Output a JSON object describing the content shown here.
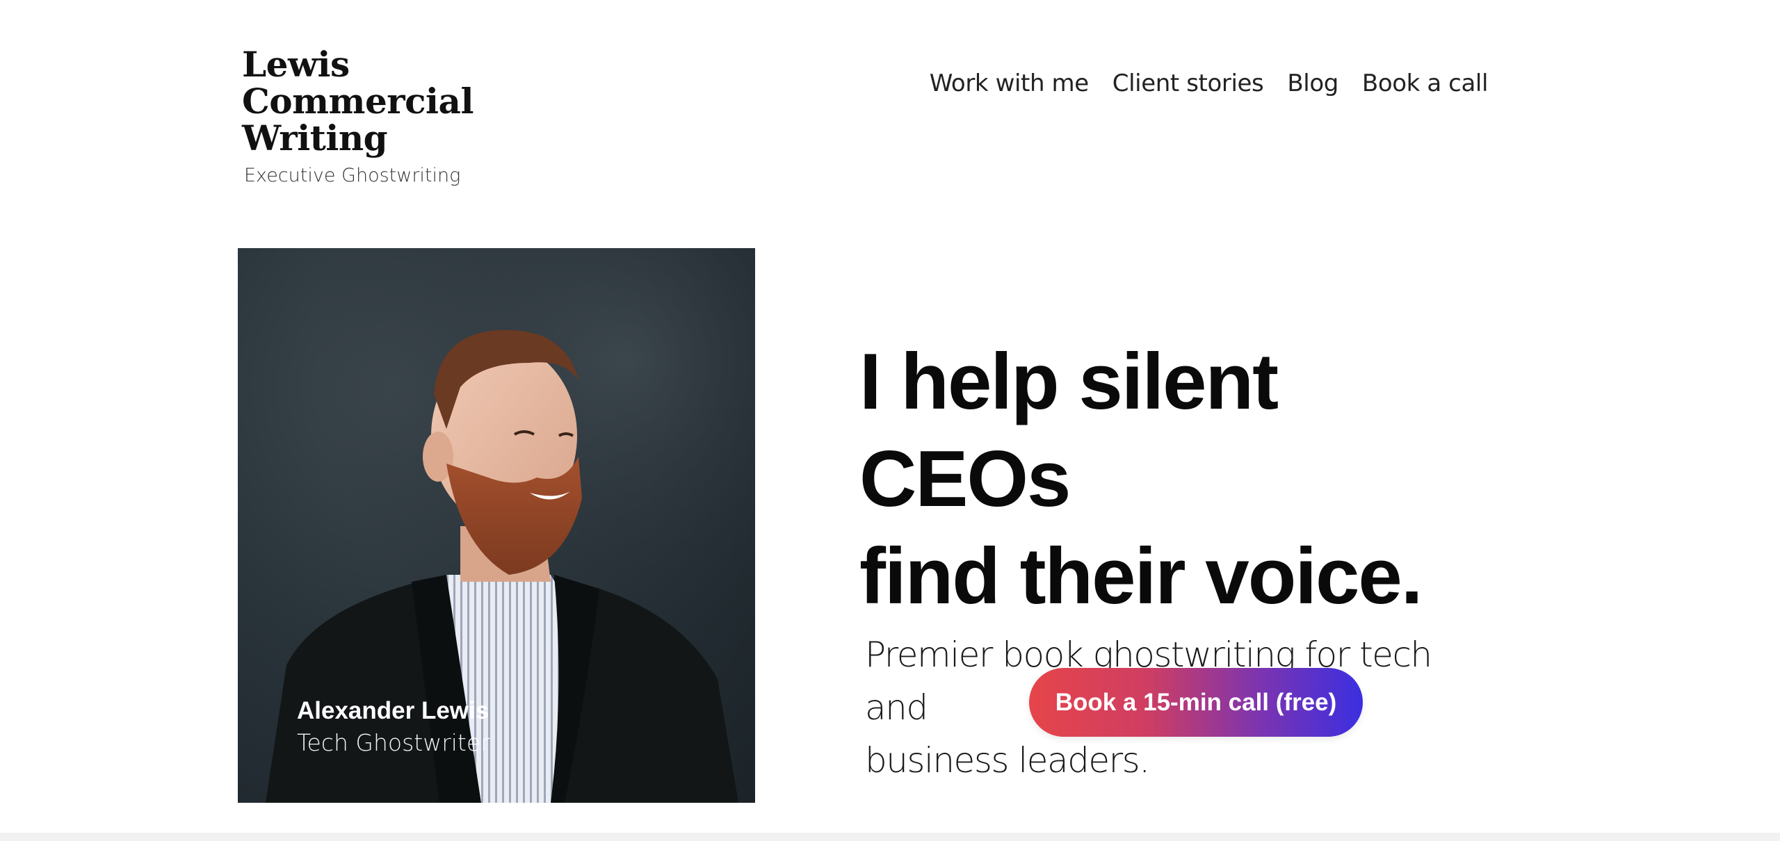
{
  "brand": {
    "title_lines": [
      "Lewis",
      "Commercial",
      "Writing"
    ],
    "tagline": "Executive Ghostwriting"
  },
  "nav": {
    "items": [
      {
        "label": "Work with me"
      },
      {
        "label": "Client stories"
      },
      {
        "label": "Blog"
      },
      {
        "label": "Book a call"
      }
    ]
  },
  "portrait": {
    "name": "Alexander Lewis",
    "role": "Tech Ghostwriter"
  },
  "hero": {
    "headline_lines": [
      "I help silent CEOs",
      "find their voice."
    ],
    "subheadline_lines": [
      "Premier book ghostwriting for tech and",
      "business leaders."
    ],
    "cta_label": "Book a 15-min call (free)"
  },
  "colors": {
    "cta_gradient_start": "#e6454a",
    "cta_gradient_end": "#3b2fe0",
    "text_primary": "#0a0a0a",
    "photo_background": "#29333a"
  }
}
